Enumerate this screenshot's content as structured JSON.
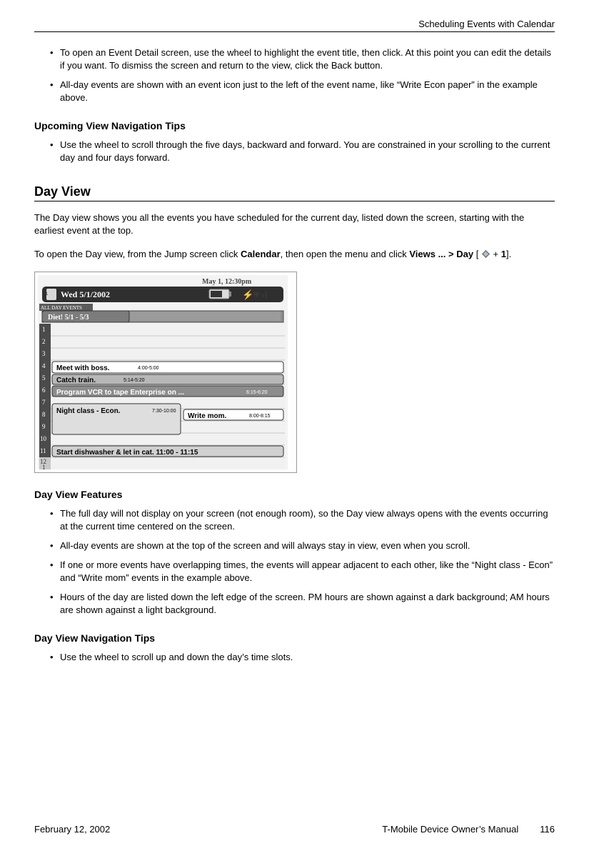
{
  "header": {
    "chapter_title": "Scheduling Events with Calendar"
  },
  "intro_bullets": [
    "To open an Event Detail screen, use the wheel to highlight the event title, then click. At this point you can edit the details if you want. To dismiss the screen and return to the view, click the Back button.",
    "All-day events are shown with an event icon just to the left of the event name, like “Write Econ paper” in the example above."
  ],
  "upcoming_tips": {
    "heading": "Upcoming View Navigation Tips",
    "bullets": [
      "Use the wheel to scroll through the five days, backward and forward. You are constrained in your scrolling to the current day and four days forward."
    ]
  },
  "day_view": {
    "heading": "Day View",
    "intro": "The Day view shows you all the events you have scheduled for the current day, listed down the screen, starting with the earliest event at the top.",
    "open_pre": "To open the Day view, from the Jump screen click ",
    "open_calendar": "Calendar",
    "open_mid": ", then open the menu and click ",
    "open_views": "Views ... > Day",
    "open_bracket_open": " [ ",
    "open_plus": " + ",
    "open_one": "1",
    "open_bracket_close": "].",
    "screenshot": {
      "clock": "May 1, 12:30pm",
      "date_pill": "Wed 5/1/2002",
      "all_day_label": "ALL DAY EVENTS",
      "all_day_event": "Diet! 5/1 - 5/3",
      "hours": [
        "1",
        "2",
        "3",
        "4",
        "5",
        "6",
        "7",
        "8",
        "9",
        "10",
        "11",
        "12",
        "1"
      ],
      "events": {
        "meet": {
          "title": "Meet with boss.",
          "time": "4:00-5:00"
        },
        "train": {
          "title": "Catch train.",
          "time": "5:14-5:20"
        },
        "vcr": {
          "title": "Program VCR to tape Enterprise on ...",
          "time": "6:15-6:20"
        },
        "night": {
          "title": "Night class - Econ.",
          "time": "7:30-10:00"
        },
        "mom": {
          "title": "Write mom.",
          "time": "8:00-8:15"
        },
        "dish": {
          "title": "Start dishwasher & let in cat.  11:00 - 11:15"
        }
      }
    },
    "features": {
      "heading": "Day View Features",
      "bullets": [
        "The full day will not display on your screen (not enough room), so the Day view always opens with the events occurring at the current time centered on the screen.",
        "All-day events are shown at the top of the screen and will always stay in view, even when you scroll.",
        "If one or more events have overlapping times, the events will appear adjacent to each other, like the “Night class - Econ” and “Write mom” events in the example above.",
        "Hours of the day are listed down the left edge of the screen. PM hours are shown against a dark background; AM hours are shown against a light background."
      ]
    },
    "nav_tips": {
      "heading": "Day View Navigation Tips",
      "bullets": [
        "Use the wheel to scroll up and down the day’s time slots."
      ]
    }
  },
  "footer": {
    "date": "February 12, 2002",
    "title": "T-Mobile Device Owner’s Manual",
    "page": "116"
  }
}
